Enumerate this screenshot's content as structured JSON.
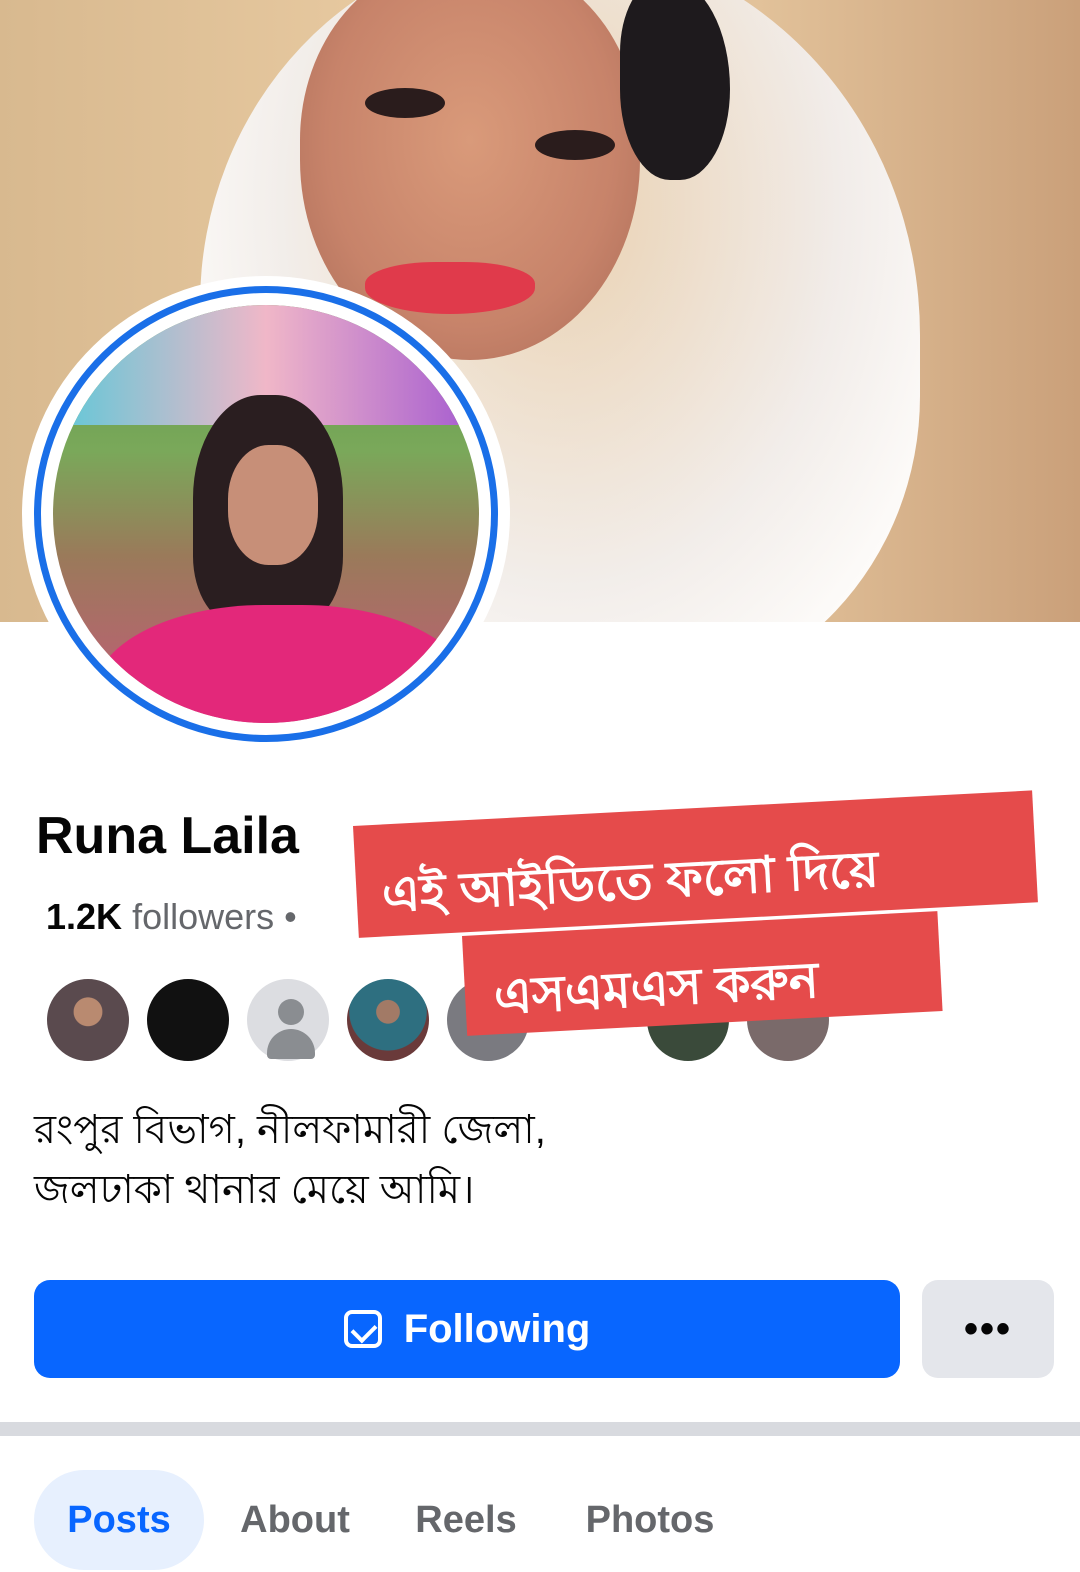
{
  "profile": {
    "name": "Runa Laila",
    "followers_count": "1.2K",
    "followers_label": "followers",
    "separator": "•"
  },
  "overlay": {
    "line1": "এই আইডিতে ফলো দিয়ে",
    "line2": "এসএমএস করুন",
    "color": "#e54b4b"
  },
  "bio": {
    "line1": "রংপুর বিভাগ, নীলফামারী জেলা,",
    "line2": "জলঢাকা থানার মেয়ে আমি।"
  },
  "actions": {
    "following_label": "Following",
    "more_label": "•••",
    "accent": "#0866ff"
  },
  "tabs": [
    {
      "label": "Posts",
      "active": true
    },
    {
      "label": "About",
      "active": false
    },
    {
      "label": "Reels",
      "active": false
    },
    {
      "label": "Photos",
      "active": false
    }
  ],
  "icons": {
    "following": "following-check-icon",
    "more": "more-dots-icon",
    "default_avatar": "default-person-icon"
  }
}
